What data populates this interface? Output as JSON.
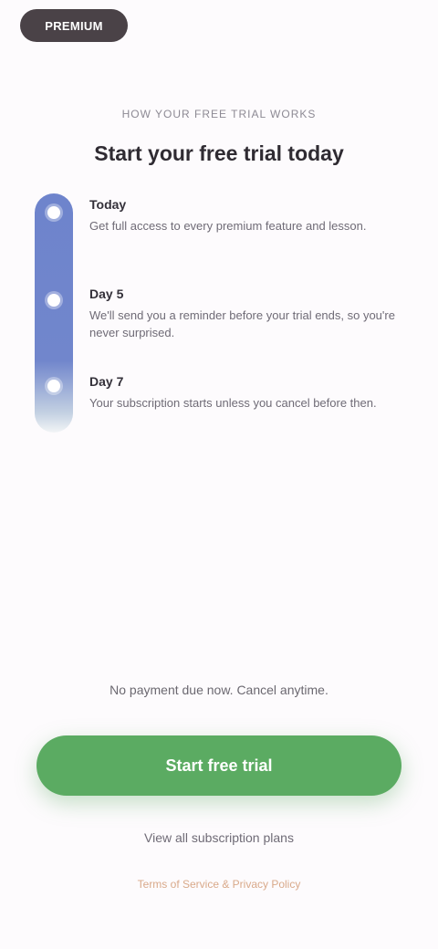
{
  "header": {
    "pill_label": "PREMIUM"
  },
  "intro": {
    "overline": "How your free trial works",
    "headline": "Start your free trial today"
  },
  "steps": [
    {
      "title": "Today",
      "description": "Get full access to every premium feature and lesson."
    },
    {
      "title": "Day 5",
      "description": "We'll send you a reminder before your trial ends, so you're never surprised."
    },
    {
      "title": "Day 7",
      "description": "Your subscription starts unless you cancel before then."
    }
  ],
  "footer": {
    "note": "No payment due now. Cancel anytime.",
    "cta_label": "Start free trial",
    "secondary_label": "View all subscription plans",
    "legal_text": "Terms of Service & Privacy Policy"
  },
  "colors": {
    "accent_green": "#5bab62",
    "rail_blue": "#6e84cc",
    "pill_dark": "#4a4247",
    "legal_orange": "#d9a98a"
  }
}
